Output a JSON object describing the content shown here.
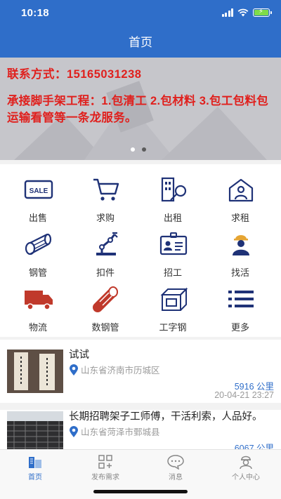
{
  "status_bar": {
    "time": "10:18"
  },
  "nav": {
    "title": "首页"
  },
  "banner": {
    "contact": "联系方式：15165031238",
    "desc": "承接脚手架工程：1.包清工 2.包材料 3.包工包料包运输看管等一条龙服务。"
  },
  "grid": [
    {
      "label": "出售",
      "icon": "sale-tag-icon"
    },
    {
      "label": "求购",
      "icon": "shopping-cart-icon"
    },
    {
      "label": "出租",
      "icon": "building-key-icon"
    },
    {
      "label": "求租",
      "icon": "house-person-icon"
    },
    {
      "label": "钢管",
      "icon": "steel-pipe-icon"
    },
    {
      "label": "扣件",
      "icon": "robot-arm-icon"
    },
    {
      "label": "招工",
      "icon": "id-card-icon"
    },
    {
      "label": "找活",
      "icon": "worker-icon"
    },
    {
      "label": "物流",
      "icon": "truck-icon"
    },
    {
      "label": "数钢管",
      "icon": "pipe-count-icon"
    },
    {
      "label": "工字钢",
      "icon": "i-beam-icon"
    },
    {
      "label": "更多",
      "icon": "more-list-icon"
    }
  ],
  "list": [
    {
      "title": "试试",
      "location": "山东省济南市历城区",
      "distance": "5916 公里",
      "time": "20-04-21 23:27"
    },
    {
      "title": "长期招聘架子工师傅，干活利索，人品好。",
      "location": "山东省菏泽市鄄城县",
      "distance": "6067 公里",
      "time": ""
    }
  ],
  "tabs": [
    {
      "label": "首页",
      "icon": "home-building-icon",
      "active": true
    },
    {
      "label": "发布需求",
      "icon": "publish-grid-icon",
      "active": false
    },
    {
      "label": "消息",
      "icon": "message-bubble-icon",
      "active": false
    },
    {
      "label": "个人中心",
      "icon": "profile-icon",
      "active": false
    }
  ],
  "colors": {
    "primary": "#2f6ec9",
    "banner_text": "#e0201d",
    "icon_navy": "#1f3277",
    "icon_red": "#c0392b"
  }
}
